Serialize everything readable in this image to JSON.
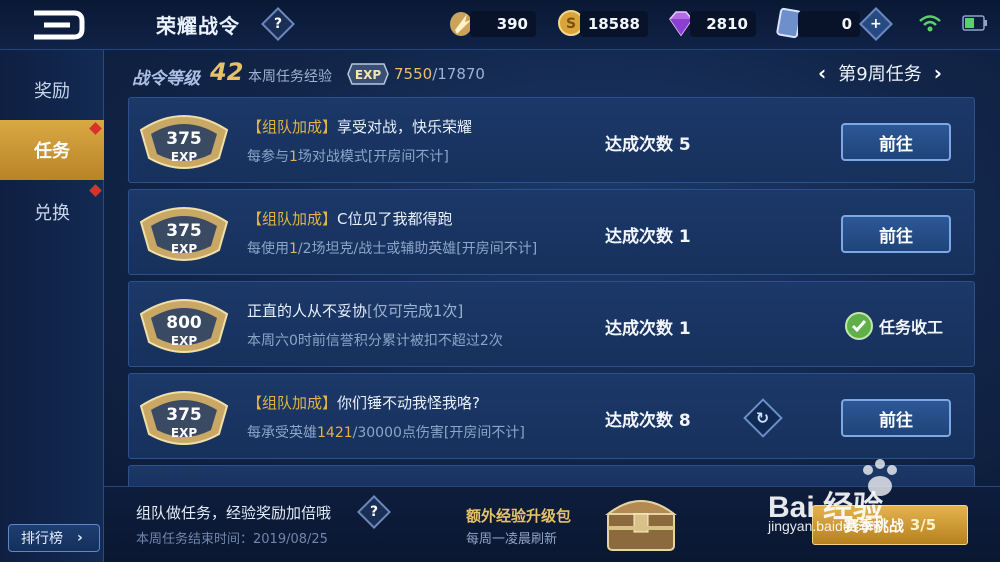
{
  "header": {
    "title": "荣耀战令",
    "help_icon": "question-icon",
    "currencies": [
      {
        "name": "token",
        "icon": "arrow-token-icon",
        "value": "390"
      },
      {
        "name": "gold",
        "icon": "gold-coin-icon",
        "value": "18588"
      },
      {
        "name": "diamond",
        "icon": "diamond-icon",
        "value": "2810"
      },
      {
        "name": "voucher",
        "icon": "voucher-card-icon",
        "value": "0"
      }
    ]
  },
  "sidebar": {
    "items": [
      {
        "label": "奖励",
        "active": false,
        "dot": false
      },
      {
        "label": "任务",
        "active": true,
        "dot": true
      },
      {
        "label": "兑换",
        "active": false,
        "dot": true
      }
    ],
    "rank_button": "排行榜"
  },
  "level": {
    "label": "战令等级",
    "value": "42",
    "week_exp_label": "本周任务经验",
    "exp_badge": "EXP",
    "exp_current": "7550",
    "exp_total": "/17870"
  },
  "week_nav": {
    "label": "第9周任务"
  },
  "tasks": [
    {
      "exp": "375",
      "exp_unit": "EXP",
      "bonus": "【组队加成】",
      "name": "享受对战，快乐荣耀",
      "desc_pre": "每参与",
      "desc_hl": "1",
      "desc_post": "场对战模式[开房间不计]",
      "count_label": "达成次数",
      "count": "5",
      "action": "前往"
    },
    {
      "exp": "375",
      "exp_unit": "EXP",
      "bonus": "【组队加成】",
      "name": "C位见了我都得跑",
      "desc_pre": "每使用",
      "desc_hl": "1",
      "desc_post": "/2场坦克/战士或辅助英雄[开房间不计]",
      "count_label": "达成次数",
      "count": "1",
      "action": "前往"
    },
    {
      "exp": "800",
      "exp_unit": "EXP",
      "name": "正直的人从不妥协",
      "limit": "[仅可完成1次]",
      "desc": "本周六0时前信誉积分累计被扣不超过2次",
      "count_label": "达成次数",
      "count": "1",
      "status": "任务收工"
    },
    {
      "exp": "375",
      "exp_unit": "EXP",
      "bonus": "【组队加成】",
      "name": "你们锤不动我怪我咯?",
      "desc_pre": "每承受英雄",
      "desc_hl": "1421",
      "desc_post": "/30000点伤害[开房间不计]",
      "count_label": "达成次数",
      "count": "8",
      "action": "前往"
    }
  ],
  "bottom": {
    "tip": "组队做任务，经验奖励加倍哦",
    "end_date": "本周任务结束时间：2019/08/25",
    "package_title": "额外经验升级包",
    "package_sub": "每周一凌晨刷新",
    "season_label": "赛季挑战",
    "season_progress": "3/5"
  },
  "watermark": {
    "logo": "Bai 经验",
    "url": "jingyan.baidu.com"
  }
}
